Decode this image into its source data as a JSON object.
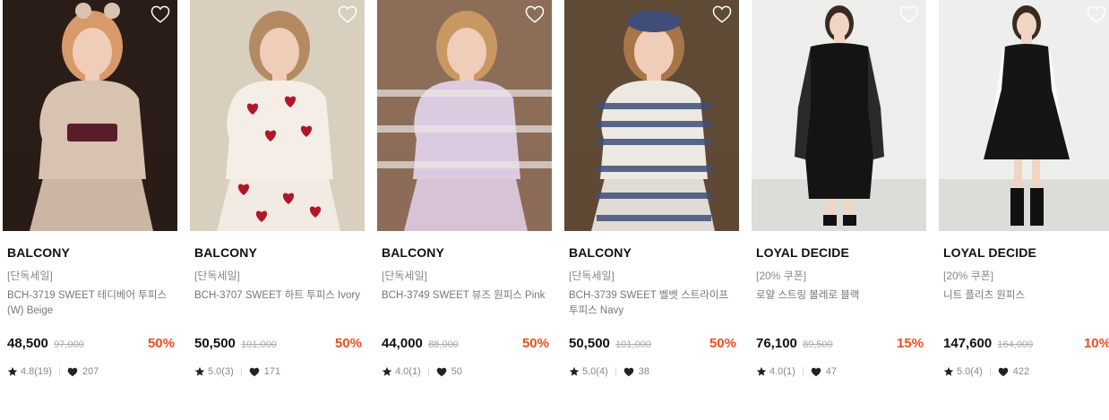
{
  "products": [
    {
      "brand": "BALCONY",
      "tag": "[단독세일]",
      "name": "BCH-3719 SWEET 테디베어 투피스 (W) Beige",
      "price": "48,500",
      "original_price": "97,000",
      "discount": "50%",
      "rating": "4.8(19)",
      "likes": "207",
      "colors": {
        "bg": "#2a1d17",
        "main": "#d8c3b0",
        "accent": "#5a1e2b",
        "skin": "#f0cdb8",
        "hair": "#d89a6a"
      }
    },
    {
      "brand": "BALCONY",
      "tag": "[단독세일]",
      "name": "BCH-3707 SWEET 하트 투피스 Ivory",
      "price": "50,500",
      "original_price": "101,000",
      "discount": "50%",
      "rating": "5.0(3)",
      "likes": "171",
      "colors": {
        "bg": "#d9cfbf",
        "main": "#f4eee6",
        "accent": "#b0182a",
        "skin": "#f0cdb8",
        "hair": "#b58a62"
      }
    },
    {
      "brand": "BALCONY",
      "tag": "[단독세일]",
      "name": "BCH-3749 SWEET 뷰즈 원피스 Pink",
      "price": "44,000",
      "original_price": "88,000",
      "discount": "50%",
      "rating": "4.0(1)",
      "likes": "50",
      "colors": {
        "bg": "#8c6d58",
        "main": "#dccbe0",
        "accent": "#e9e6e4",
        "skin": "#f0cdb8",
        "hair": "#c99862"
      }
    },
    {
      "brand": "BALCONY",
      "tag": "[단독세일]",
      "name": "BCH-3739 SWEET 벨벳 스트라이프 투피스 Navy",
      "price": "50,500",
      "original_price": "101,000",
      "discount": "50%",
      "rating": "5.0(4)",
      "likes": "38",
      "colors": {
        "bg": "#5f4a36",
        "main": "#ece8e2",
        "accent": "#3f4d78",
        "skin": "#f0cdb8",
        "hair": "#a87548"
      }
    },
    {
      "brand": "LOYAL DECIDE",
      "tag": "[20% 쿠폰]",
      "name": "로얄 스트링 볼레로 블랙",
      "price": "76,100",
      "original_price": "89,500",
      "discount": "15%",
      "rating": "4.0(1)",
      "likes": "47",
      "colors": {
        "bg": "#ededeb",
        "main": "#141414",
        "accent": "#2a2a2a",
        "skin": "#f0d5c4",
        "hair": "#3a2a20"
      }
    },
    {
      "brand": "LOYAL DECIDE",
      "tag": "[20% 쿠폰]",
      "name": "니트 플리츠 원피스",
      "price": "147,600",
      "original_price": "164,000",
      "discount": "10%",
      "rating": "5.0(4)",
      "likes": "422",
      "colors": {
        "bg": "#eeeeec",
        "main": "#151515",
        "accent": "#fafafa",
        "skin": "#f0d5c4",
        "hair": "#3a2a20"
      }
    }
  ]
}
